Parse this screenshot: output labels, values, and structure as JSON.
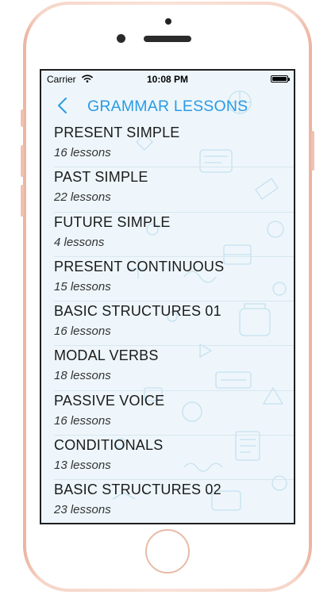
{
  "status_bar": {
    "carrier": "Carrier",
    "time": "10:08 PM"
  },
  "nav": {
    "title": "GRAMMAR LESSONS",
    "back_icon": "chevron-left-icon"
  },
  "colors": {
    "accent": "#2a9be4",
    "phone_frame": "#f6d6c9",
    "screen_bg": "#eef6fb"
  },
  "lessons": [
    {
      "title": "PRESENT SIMPLE",
      "count": "16 lessons"
    },
    {
      "title": "PAST SIMPLE",
      "count": "22 lessons"
    },
    {
      "title": "FUTURE SIMPLE",
      "count": "4 lessons"
    },
    {
      "title": "PRESENT CONTINUOUS",
      "count": "15 lessons"
    },
    {
      "title": "BASIC STRUCTURES 01",
      "count": "16 lessons"
    },
    {
      "title": "MODAL VERBS",
      "count": "18 lessons"
    },
    {
      "title": "PASSIVE VOICE",
      "count": "16 lessons"
    },
    {
      "title": "CONDITIONALS",
      "count": "13 lessons"
    },
    {
      "title": "BASIC STRUCTURES 02",
      "count": "23 lessons"
    }
  ]
}
